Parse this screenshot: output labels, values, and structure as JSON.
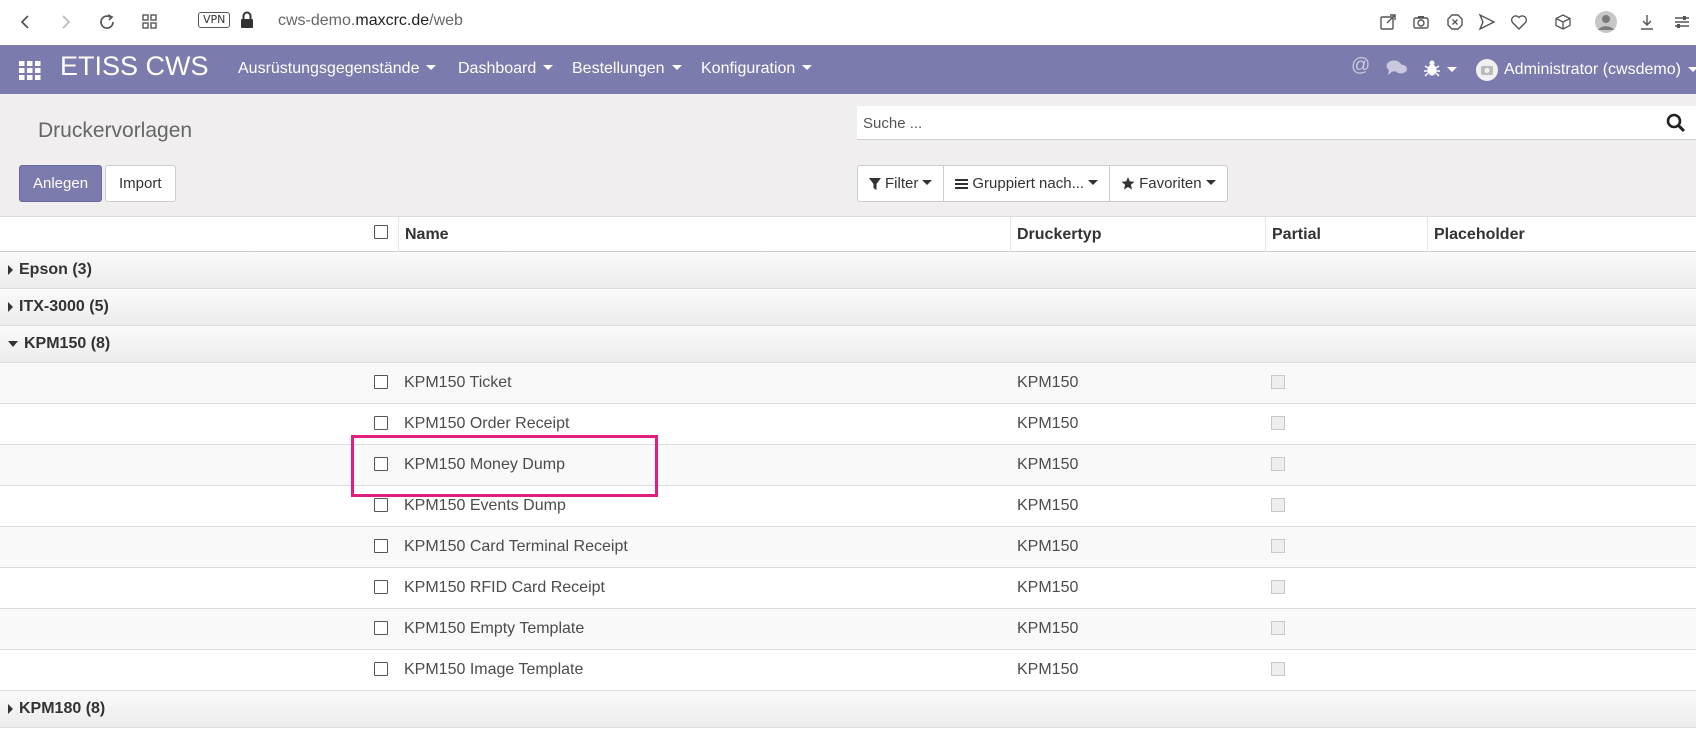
{
  "browser": {
    "vpn_label": "VPN",
    "url_subdomain": "cws-demo.",
    "url_domain": "maxcrc.de",
    "url_path": "/web"
  },
  "navbar": {
    "brand": "ETISS CWS",
    "menus": [
      {
        "label": "Ausrüstungsgegenstände"
      },
      {
        "label": "Dashboard"
      },
      {
        "label": "Bestellungen"
      },
      {
        "label": "Konfiguration"
      }
    ],
    "user": "Administrator (cwsdemo)"
  },
  "control_panel": {
    "title": "Druckervorlagen",
    "create_label": "Anlegen",
    "import_label": "Import",
    "search_placeholder": "Suche ...",
    "filter_label": "Filter",
    "group_label": "Gruppiert nach...",
    "favorites_label": "Favoriten"
  },
  "table": {
    "columns": [
      "Name",
      "Druckertyp",
      "Partial",
      "Placeholder"
    ],
    "groups": [
      {
        "label": "Epson (3)",
        "expanded": false
      },
      {
        "label": "ITX-3000 (5)",
        "expanded": false
      },
      {
        "label": "KPM150 (8)",
        "expanded": true
      },
      {
        "label": "KPM180 (8)",
        "expanded": false
      }
    ],
    "rows": [
      {
        "name": "KPM150 Ticket",
        "type": "KPM150"
      },
      {
        "name": "KPM150 Order Receipt",
        "type": "KPM150"
      },
      {
        "name": "KPM150 Money Dump",
        "type": "KPM150"
      },
      {
        "name": "KPM150 Events Dump",
        "type": "KPM150"
      },
      {
        "name": "KPM150 Card Terminal Receipt",
        "type": "KPM150"
      },
      {
        "name": "KPM150 RFID Card Receipt",
        "type": "KPM150"
      },
      {
        "name": "KPM150 Empty Template",
        "type": "KPM150"
      },
      {
        "name": "KPM150 Image Template",
        "type": "KPM150"
      }
    ]
  },
  "colors": {
    "navbar": "#7c7bad",
    "highlight": "#e21f7e"
  }
}
